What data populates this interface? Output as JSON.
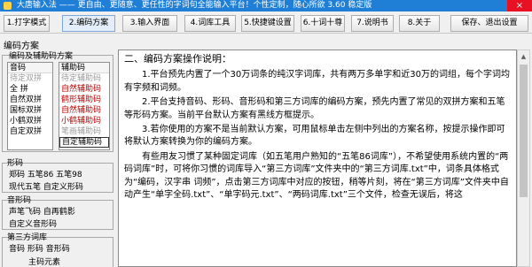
{
  "window": {
    "title": "大唐输入法 —— 更自由、更随意、更任性的字词句全能输入平台！个性定制，随心所欲   3.60 稳定版",
    "close_glyph": "×"
  },
  "toolbar": {
    "buttons": [
      {
        "label": "1.打字模式"
      },
      {
        "label": "2.编码方案"
      },
      {
        "label": "3.输入界面"
      },
      {
        "label": "4.词库工具"
      },
      {
        "label": "5.快捷键设置"
      },
      {
        "label": "6.十词十尊"
      },
      {
        "label": "7.说明书"
      },
      {
        "label": "8.关于"
      },
      {
        "label": "保存、退出设置"
      }
    ]
  },
  "panel": {
    "title": "编码方案",
    "scheme_group": {
      "title": "编码及辅助码方案",
      "yinma": {
        "header": "音码",
        "items": [
          "待定双拼",
          "全 拼",
          "自然双拼",
          "国标双拼",
          "小鹤双拼",
          "自定双拼"
        ]
      },
      "fuzhuma": {
        "header": "辅助码",
        "items": [
          "待定辅助码",
          "自然辅助码",
          "鹤形辅助码",
          "自然辅助码",
          "小鹤辅助码",
          "笔画辅助码",
          "自定辅助码"
        ]
      }
    },
    "xingma": {
      "title": "形码",
      "line1": "郑码   五笔86  五笔98",
      "line2": "现代五笔    自定义形码"
    },
    "yinxing": {
      "title": "音形码",
      "line1": "声笔飞码  自再鹤影",
      "line2": "自定义音形码"
    },
    "third": {
      "title": "第三方词库",
      "line1": "音码  形码  音形码",
      "line2": "主码元素"
    }
  },
  "doc": {
    "heading": "二、编码方案操作说明：",
    "paragraphs": [
      "1.平台预先内置了一个30万词条的纯汉字词库，共有两万多单字和近30万的词组，每个字词均有字频和词频。",
      "2.平台支持音码、形码、音形码和第三方词库的编码方案，预先内置了常见的双拼方案和五笔等形码方案。当前平台默认方案有黑线方框提示。",
      "3.若你使用的方案不是当前默认方案，可用鼠标单击左侧中列出的方案名称，按提示操作即可将默认方案转换为你的编码方案。",
      "有些用友习惯了某种固定词库（如五笔用户熟知的“五笔86词库”），不希望使用系统内置的“两码词库”时，可将你习惯的词库导入“第三方词库”文件夹中的“第三方词库.txt”中，词条具体格式为“编码，汉字串 词频”，点击第三方词库中对应的按钮，稍等片刻，将在“第三方词库”文件夹中自动产生“单字全码.txt”、“单字码元.txt”、“两码词库.txt”三个文件，检查无误后，将这"
    ]
  }
}
